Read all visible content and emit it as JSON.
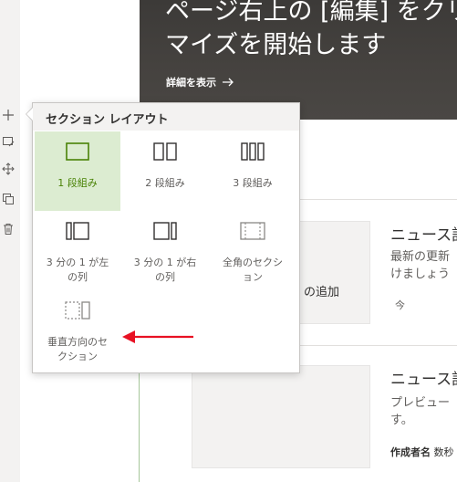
{
  "hero": {
    "title": "ページ右上の [編集] をクリ\nマイズを開始します",
    "link_label": "詳細を表示"
  },
  "left_rail": {
    "icons": [
      "plus-icon",
      "edit-icon",
      "move-icon",
      "duplicate-icon",
      "delete-icon"
    ]
  },
  "news": {
    "items": [
      {
        "title": "ニュース記",
        "description": "最新の更新\nけましょう",
        "time": "今",
        "thumb_caption": "の追加"
      },
      {
        "title": "ニュース記",
        "description": "プレビュー\nす。",
        "author_label": "作成者名",
        "author_value": "数秒"
      }
    ]
  },
  "section_layout": {
    "title": "セクション レイアウト",
    "options": [
      {
        "label": "1 段組み",
        "icon": "one-column-icon",
        "selected": true
      },
      {
        "label": "2 段組み",
        "icon": "two-column-icon",
        "selected": false
      },
      {
        "label": "3 段組み",
        "icon": "three-column-icon",
        "selected": false
      },
      {
        "label": "3 分の 1 が左\nの列",
        "icon": "one-third-left-icon",
        "selected": false
      },
      {
        "label": "3 分の 1 が右\nの列",
        "icon": "one-third-right-icon",
        "selected": false
      },
      {
        "label": "全角のセクシ\nョン",
        "icon": "full-width-section-icon",
        "selected": false
      },
      {
        "label": "垂直方向のセ\nクション",
        "icon": "vertical-section-icon",
        "selected": false
      }
    ]
  },
  "colors": {
    "accent_green": "#498205",
    "selected_bg": "#dcecd1",
    "arrow_red": "#e81123"
  }
}
